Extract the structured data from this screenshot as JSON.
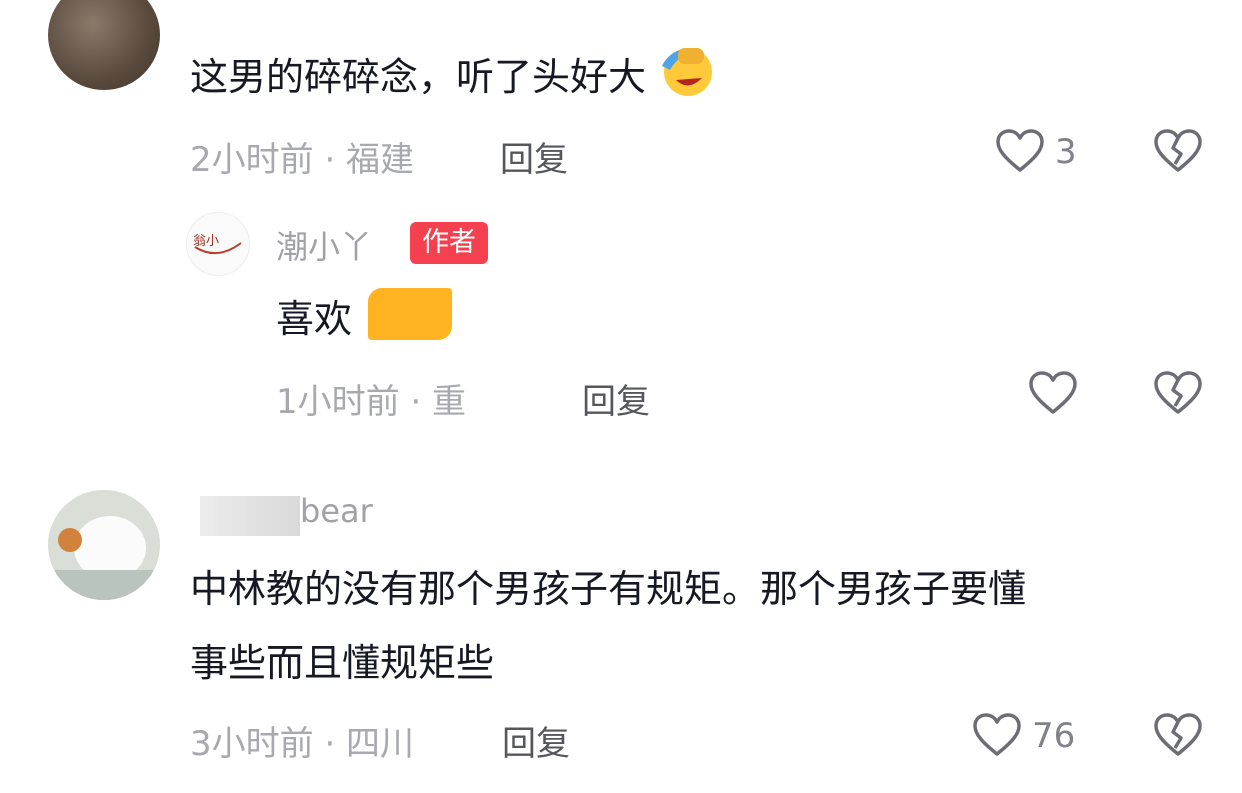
{
  "comments": [
    {
      "text": "这男的碎碎念，听了头好大",
      "emoji_icon": "facepalm-laugh-emoji-icon",
      "time_location": "2小时前 · 福建",
      "reply_label": "回复",
      "likes": "3"
    },
    {
      "username": "潮小丫",
      "author_badge": "作者",
      "text": "喜欢",
      "time_location": "1小时前 · 重",
      "reply_label": "回复"
    },
    {
      "username": "bear",
      "text_line1": "中林教的没有那个男孩子有规矩。那个男孩子要懂",
      "text_line2": "事些而且懂规矩些",
      "time_location": "3小时前 · 四川",
      "reply_label": "回复",
      "likes": "76"
    }
  ],
  "colors": {
    "badge": "#f5404f",
    "text": "#161823",
    "meta": "#a8a9ae"
  }
}
